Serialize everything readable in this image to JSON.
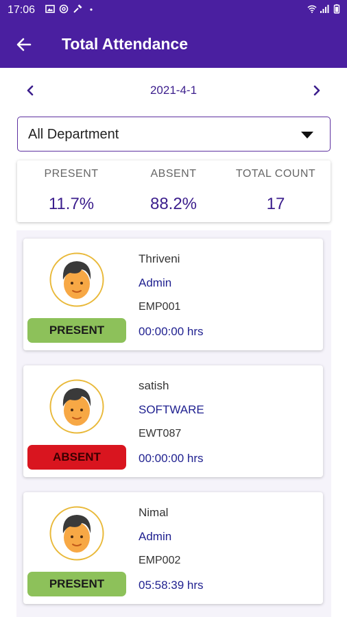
{
  "status_bar": {
    "time": "17:06",
    "icons_left": [
      "image-icon",
      "at-sign-icon",
      "tool-icon",
      "dot-icon"
    ],
    "icons_right": [
      "wifi-icon",
      "signal-icon",
      "battery-icon"
    ]
  },
  "toolbar": {
    "title": "Total Attendance",
    "back_icon": "arrow-left-icon"
  },
  "date_nav": {
    "date": "2021-4-1",
    "prev_icon": "chevron-left-icon",
    "next_icon": "chevron-right-icon"
  },
  "department": {
    "selected": "All Department",
    "caret_icon": "dropdown-triangle-icon"
  },
  "summary": {
    "present_label": "PRESENT",
    "present_value": "11.7%",
    "absent_label": "ABSENT",
    "absent_value": "88.2%",
    "total_label": "TOTAL COUNT",
    "total_value": "17"
  },
  "colors": {
    "primary": "#4a1fa0",
    "accent_text": "#3b1d8c",
    "present": "#8dc15a",
    "absent": "#d9151f"
  },
  "employees": [
    {
      "name": "Thriveni",
      "department": "Admin",
      "emp_id": "EMP001",
      "hours": "00:00:00 hrs",
      "status": "PRESENT"
    },
    {
      "name": "satish",
      "department": "SOFTWARE",
      "emp_id": "EWT087",
      "hours": "00:00:00 hrs",
      "status": "ABSENT"
    },
    {
      "name": "Nimal",
      "department": "Admin",
      "emp_id": "EMP002",
      "hours": "05:58:39 hrs",
      "status": "PRESENT"
    }
  ]
}
